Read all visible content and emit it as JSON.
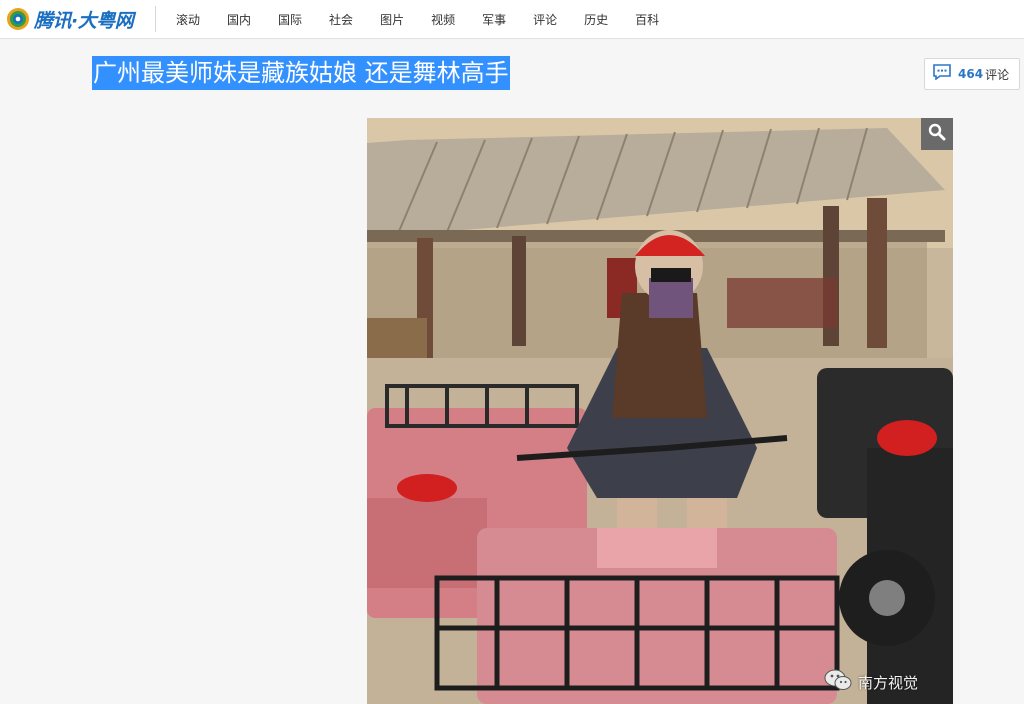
{
  "header": {
    "logo_text": "腾讯·大粤网",
    "nav": [
      "滚动",
      "国内",
      "国际",
      "社会",
      "图片",
      "视频",
      "军事",
      "评论",
      "历史",
      "百科"
    ]
  },
  "article": {
    "title": "广州最美师妹是藏族姑娘 还是舞林高手",
    "comments": {
      "count": "464",
      "label": "评论"
    },
    "photo": {
      "watermark": "南方视觉"
    }
  },
  "colors": {
    "brand_blue": "#1b6fc0",
    "selection_blue": "#3390ff",
    "count_blue": "#2a76c6"
  },
  "icons": [
    "logo-mark-icon",
    "comment-bubble-icon",
    "magnifier-icon",
    "wechat-icon"
  ]
}
